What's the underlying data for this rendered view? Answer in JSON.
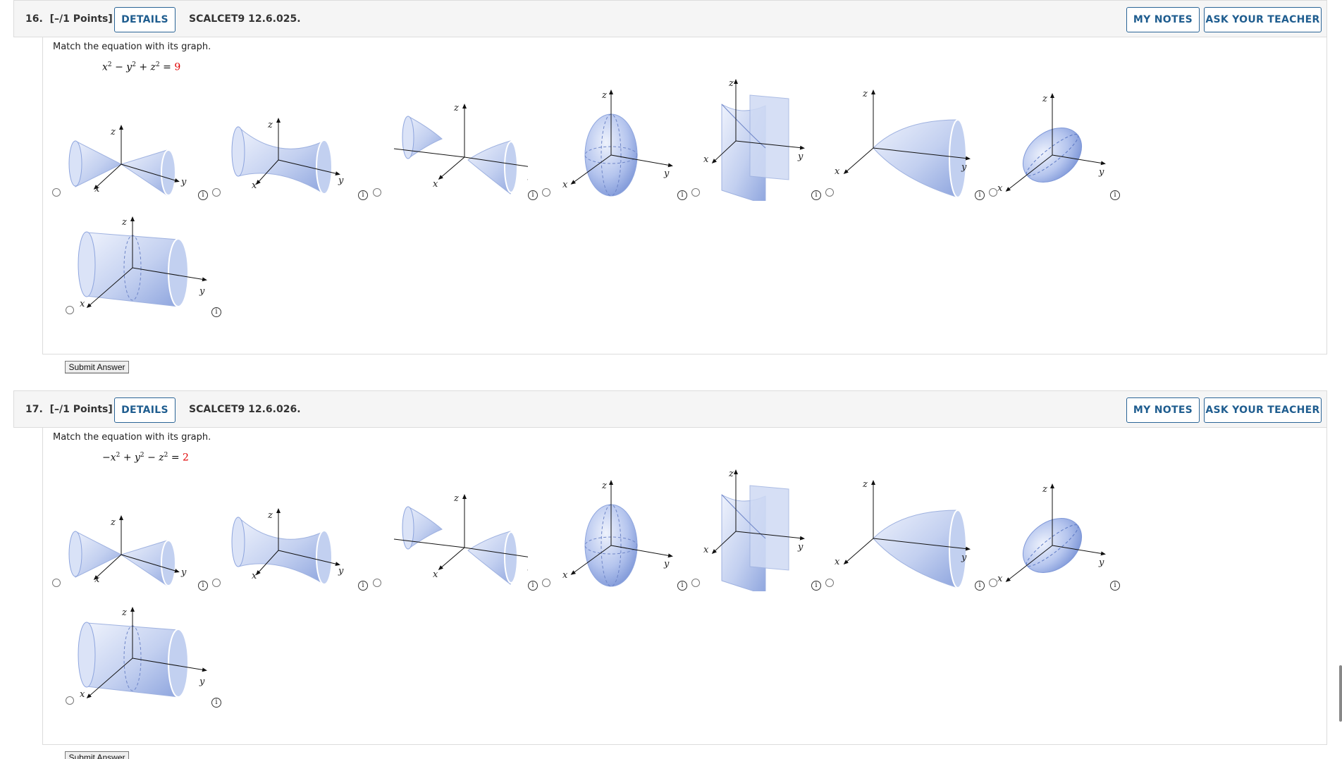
{
  "questions": [
    {
      "number": "16.",
      "points": "[–/1 Points]",
      "details_label": "DETAILS",
      "code": "SCALCET9 12.6.025.",
      "my_notes_label": "MY NOTES",
      "ask_label": "ASK YOUR TEACHER",
      "prompt": "Match the equation with its graph.",
      "equation": {
        "t1": "x",
        "t2": " − y",
        "t3": " + z",
        "eq": " = ",
        "rhs": "9"
      },
      "submit_label": "Submit Answer"
    },
    {
      "number": "17.",
      "points": "[–/1 Points]",
      "details_label": "DETAILS",
      "code": "SCALCET9 12.6.026.",
      "my_notes_label": "MY NOTES",
      "ask_label": "ASK YOUR TEACHER",
      "prompt": "Match the equation with its graph.",
      "equation": {
        "t1": "−x",
        "t2": " + y",
        "t3": " − z",
        "eq": " = ",
        "rhs": "2"
      },
      "submit_label": "Submit Answer"
    }
  ],
  "graph_options": [
    "double-cone",
    "hyperboloid-one-sheet",
    "hyperboloid-two-sheets",
    "ellipsoid",
    "hyperbolic-paraboloid",
    "elliptic-paraboloid",
    "tilted-ellipsoid",
    "elliptic-cylinder"
  ],
  "axis_labels": {
    "x": "x",
    "y": "y",
    "z": "z"
  },
  "info_glyph": "i",
  "colors": {
    "accent": "#1f5d8f",
    "surface_fill": "#b9c8ee",
    "surface_stroke": "#5b78c4",
    "rhs": "#e00000"
  }
}
